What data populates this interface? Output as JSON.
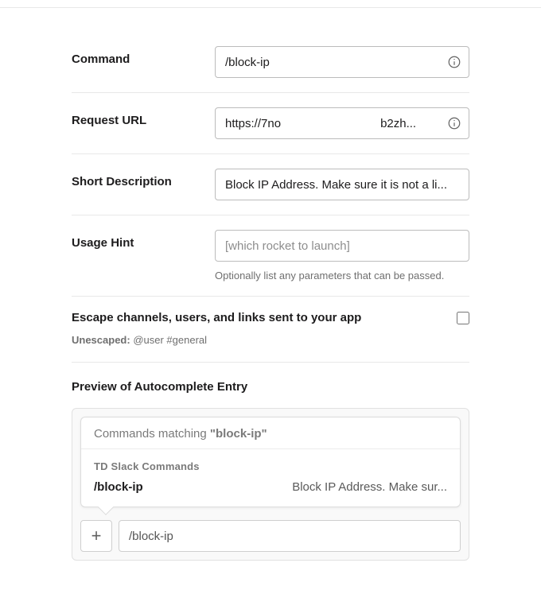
{
  "fields": {
    "command": {
      "label": "Command",
      "value": "/block-ip"
    },
    "request_url": {
      "label": "Request URL",
      "value": "https://7no                              b2zh..."
    },
    "short_desc": {
      "label": "Short Description",
      "value": "Block IP Address. Make sure it is not a li..."
    },
    "usage_hint": {
      "label": "Usage Hint",
      "placeholder": "[which rocket to launch]",
      "helper": "Optionally list any parameters that can be passed."
    }
  },
  "escape": {
    "label": "Escape channels, users, and links sent to your app",
    "sub_strong": "Unescaped:",
    "sub_text": " @user #general",
    "checked": false
  },
  "preview": {
    "title": "Preview of Autocomplete Entry",
    "matching_prefix": "Commands matching ",
    "matching_query": "\"block-ip\"",
    "app_name": "TD Slack Commands",
    "cmd": "/block-ip",
    "cmd_desc": "Block IP Address. Make sur...",
    "compose_value": "/block-ip"
  }
}
